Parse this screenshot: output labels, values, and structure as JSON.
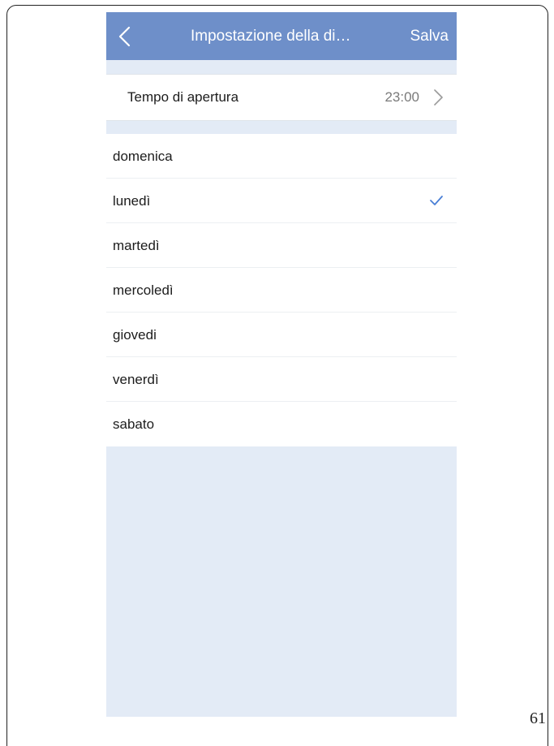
{
  "header": {
    "title": "Impostazione della di…",
    "save_label": "Salva",
    "back_icon": "chevron-left-icon"
  },
  "opening_time": {
    "label": "Tempo di apertura",
    "value": "23:00",
    "icon": "chevron-right-icon"
  },
  "days": [
    {
      "label": "domenica",
      "checked": false
    },
    {
      "label": "lunedì",
      "checked": true
    },
    {
      "label": "martedì",
      "checked": false
    },
    {
      "label": "mercoledì",
      "checked": false
    },
    {
      "label": "giovedi",
      "checked": false
    },
    {
      "label": "venerdì",
      "checked": false
    },
    {
      "label": "sabato",
      "checked": false
    }
  ],
  "page_number": "61",
  "colors": {
    "header_bg": "#6e8fc9",
    "screen_bg": "#e3ebf6",
    "check": "#4a7fd6"
  }
}
